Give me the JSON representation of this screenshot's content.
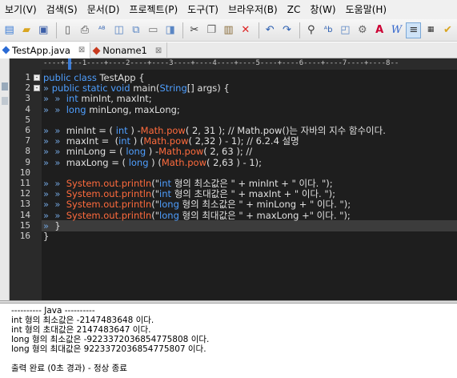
{
  "menu": [
    "보기(V)",
    "검색(S)",
    "문서(D)",
    "프로젝트(P)",
    "도구(T)",
    "브라우저(B)",
    "ZC",
    "창(W)",
    "도움말(H)"
  ],
  "toolbar": {
    "icons": [
      "new-file-icon",
      "open-folder-icon",
      "save-icon",
      "save-all-icon",
      "print-preview-icon",
      "print-icon",
      "spellcheck-icon",
      "view-icon",
      "copy-view-icon",
      "file-icon",
      "window-icon",
      "cut-icon",
      "copy-icon",
      "paste-icon",
      "delete-icon",
      "undo-icon",
      "redo-icon",
      "find-icon",
      "replace-icon",
      "find-in-files-icon",
      "settings-icon",
      "bold-icon",
      "italic-icon",
      "wordwrap-icon",
      "ruler-icon",
      "checkmark-icon"
    ]
  },
  "tabs": [
    {
      "label": "TestApp.java",
      "active": true,
      "color": "#2a6ad4"
    },
    {
      "label": "Noname1",
      "active": false,
      "color": "#c83a1e"
    }
  ],
  "ruler": {
    "marks": [
      "----+----1----+----2----+----3----+----4----+----5----+----6----+----7----+----8--"
    ]
  },
  "editor": {
    "current_line": 15,
    "lines": [
      {
        "n": "1",
        "fold": "-",
        "text": "public class TestApp {"
      },
      {
        "n": "2",
        "fold": "-",
        "text": "» public static void main(String[] args) {"
      },
      {
        "n": "3",
        "fold": "",
        "text": "»  »  int minInt, maxInt;"
      },
      {
        "n": "4",
        "fold": "",
        "text": "»  »  long minLong, maxLong;"
      },
      {
        "n": "5",
        "fold": "",
        "text": ""
      },
      {
        "n": "6",
        "fold": "",
        "text": "»  »  minInt = ( int ) -Math.pow( 2, 31 ); // Math.pow()는 자바의 지수 함수이다."
      },
      {
        "n": "7",
        "fold": "",
        "text": "»  »  maxInt =  (int ) (Math.pow( 2,32 ) - 1); // 6.2.4 설명"
      },
      {
        "n": "8",
        "fold": "",
        "text": "»  »  minLong = ( long ) -Math.pow( 2, 63 ); //"
      },
      {
        "n": "9",
        "fold": "",
        "text": "»  »  maxLong = ( long ) (Math.pow( 2,63 ) - 1);"
      },
      {
        "n": "10",
        "fold": "",
        "text": ""
      },
      {
        "n": "11",
        "fold": "",
        "text": "»  »  System.out.println(\"int 형의 최소값은 \" + minInt + \" 이다. \");"
      },
      {
        "n": "12",
        "fold": "",
        "text": "»  »  System.out.println(\"int 형의 초대값은 \" + maxInt + \" 이다. \");"
      },
      {
        "n": "13",
        "fold": "",
        "text": "»  »  System.out.println(\"long 형의 최소값은 \" + minLong + \" 이다. \");"
      },
      {
        "n": "14",
        "fold": "",
        "text": "»  »  System.out.println(\"long 형의 최대값은 \" + maxLong +\" 이다. \");"
      },
      {
        "n": "15",
        "fold": "",
        "text": "»  }"
      },
      {
        "n": "16",
        "fold": "",
        "text": "}"
      }
    ]
  },
  "output": {
    "lines": [
      "---------- Java ----------",
      "int 형의 최소값은 -2147483648 이다.",
      "int 형의 초대값은 2147483647 이다.",
      "long 형의 최소값은 -9223372036854775808 이다.",
      "long 형의 최대값은 9223372036854775807 이다.",
      "",
      "출력 완료 (0초 경과) - 정상 종료"
    ]
  }
}
